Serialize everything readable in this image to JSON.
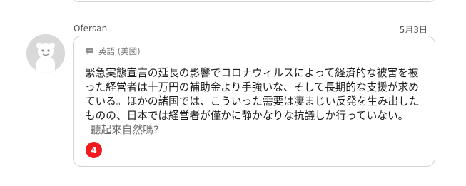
{
  "post": {
    "username": "Ofersan",
    "date": "5月3日",
    "language_label": "英語 (美國)",
    "body": "緊急実態宣言の延長の影響でコロナウィルスによって経済的な被害を被った経営者は十万円の補助金より手強いな、そして長期的な支援が求めている。ほかの諸国では、こういった需要は凄まじい反発を生み出したものの、日本では経営者が僅かに静かなりな抗議しか行っていない。",
    "translate_link": "聽起來自然嗎?",
    "count_badge": "4"
  },
  "icons": {
    "avatar": "default-avatar-icon",
    "language": "speech-bubble-icon"
  },
  "colors": {
    "badge": "#f2191f",
    "border": "#d3d3d3",
    "avatar_bg": "#d9d9d9"
  }
}
